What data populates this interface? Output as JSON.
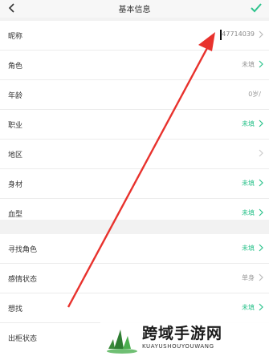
{
  "header": {
    "title": "基本信息",
    "back_icon": "chevron-left-icon",
    "confirm_icon": "check-icon",
    "accent": "#2ec38d"
  },
  "section1": {
    "rows": [
      {
        "label": "昵称",
        "value": "47714039"
      },
      {
        "label": "角色",
        "value": "未填"
      },
      {
        "label": "年龄",
        "value": "0岁/"
      },
      {
        "label": "职业",
        "value": "未填"
      },
      {
        "label": "地区",
        "value": ""
      },
      {
        "label": "身材",
        "value": "未填"
      },
      {
        "label": "血型",
        "value": "未填"
      }
    ]
  },
  "section2": {
    "rows": [
      {
        "label": "寻找角色",
        "value": "未填"
      },
      {
        "label": "感情状态",
        "value": "单身"
      },
      {
        "label": "想找",
        "value": "未填"
      },
      {
        "label": "出柜状态",
        "value": ""
      }
    ]
  },
  "watermark": {
    "text": "跨域手游网",
    "subtext": "KUAYUSHOUYOUWANG"
  },
  "colors": {
    "muted": "#999999",
    "green": "#2ec38d",
    "arrow": "#e8322d"
  }
}
